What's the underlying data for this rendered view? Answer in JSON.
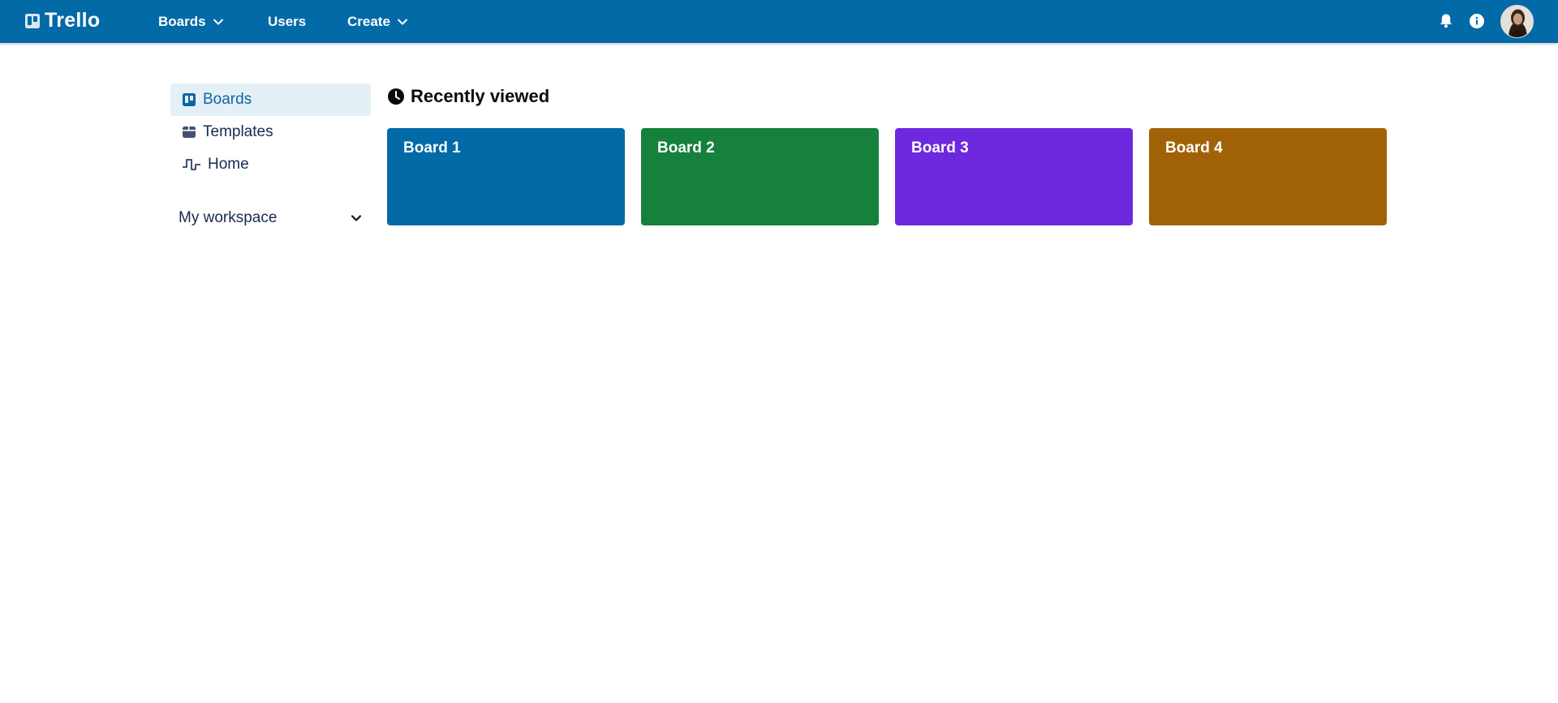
{
  "header": {
    "logo_text": "Trello",
    "nav": {
      "boards_label": "Boards",
      "users_label": "Users",
      "create_label": "Create"
    },
    "icons": [
      "bell-icon",
      "info-icon",
      "user-avatar"
    ]
  },
  "sidebar": {
    "items": [
      {
        "label": "Boards",
        "icon": "board-icon",
        "active": true
      },
      {
        "label": "Templates",
        "icon": "template-icon",
        "active": false
      },
      {
        "label": "Home",
        "icon": "pulse-icon",
        "active": false
      }
    ],
    "workspace_label": "My workspace"
  },
  "main": {
    "section_title": "Recently viewed",
    "boards": [
      {
        "title": "Board 1",
        "color": "#026aa7"
      },
      {
        "title": "Board 2",
        "color": "#16803d"
      },
      {
        "title": "Board 3",
        "color": "#6e28de"
      },
      {
        "title": "Board 4",
        "color": "#a16207"
      }
    ]
  },
  "colors": {
    "header_bg": "#026aa7",
    "active_item_bg": "#e4f0f6",
    "active_item_text": "#0c66a4"
  }
}
